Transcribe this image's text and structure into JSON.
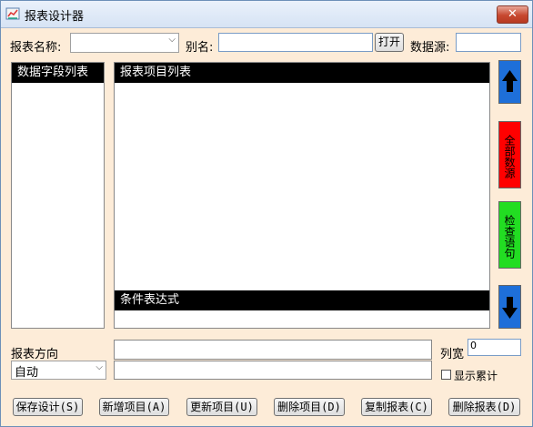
{
  "window": {
    "title": "报表设计器",
    "close_label": "✕"
  },
  "header": {
    "report_name_label": "报表名称:",
    "report_name_value": "",
    "alias_label": "别名:",
    "alias_value": "",
    "open_label": "打开",
    "datasource_label": "数据源:",
    "datasource_value": ""
  },
  "panels": {
    "fields_header": "数据字段列表",
    "items_header": "报表项目列表",
    "condition_header": "条件表达式"
  },
  "side_buttons": {
    "all_sources": "全部数源",
    "check_statement": "检查语句"
  },
  "bottom": {
    "direction_label": "报表方向",
    "direction_value": "自动",
    "column_width_label": "列宽",
    "column_width_value": "0",
    "show_cumulative_label": "显示累计",
    "show_cumulative_checked": false
  },
  "actions": [
    "保存设计(S)",
    "新增项目(A)",
    "更新项目(U)",
    "删除项目(D)",
    "复制报表(C)",
    "删除报表(D)"
  ],
  "colors": {
    "up_arrow": "#1e6fd9",
    "all_sources_bg": "#ff0000",
    "check_bg": "#22dd22",
    "down_arrow": "#1e6fd9"
  },
  "icons": {
    "up": "arrow-up-icon",
    "down": "arrow-down-icon",
    "app": "designer-icon"
  }
}
